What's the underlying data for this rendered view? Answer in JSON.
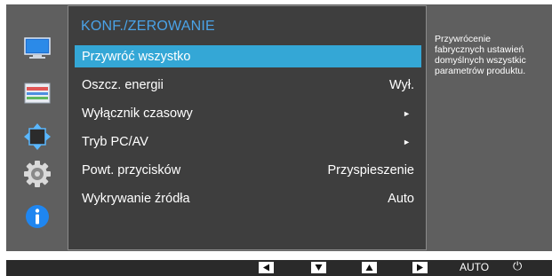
{
  "menu": {
    "title": "KONF./ZEROWANIE",
    "items": [
      {
        "label": "Przywróć wszystko",
        "value": "",
        "arrow": ""
      },
      {
        "label": "Oszcz. energii",
        "value": "Wył.",
        "arrow": ""
      },
      {
        "label": "Wyłącznik czasowy",
        "value": "",
        "arrow": "►"
      },
      {
        "label": "Tryb PC/AV",
        "value": "",
        "arrow": "►"
      },
      {
        "label": "Powt. przycisków",
        "value": "Przyspieszenie",
        "arrow": ""
      },
      {
        "label": "Wykrywanie źródła",
        "value": "Auto",
        "arrow": ""
      }
    ]
  },
  "description": {
    "lines": [
      "Przywrócenie",
      "fabrycznych ustawień",
      "domyślnych wszystkic",
      "parametrów produktu."
    ]
  },
  "sidebar": {
    "icons": [
      "monitor-icon",
      "color-bars-icon",
      "resize-arrows-icon",
      "gear-icon",
      "info-icon"
    ]
  },
  "buttons": {
    "auto_label": "AUTO",
    "power_symbol": "⏻"
  },
  "colors": {
    "accent": "#34a7d6",
    "title": "#4aa3e8",
    "panel": "#3e3e3e",
    "frame": "#5f5f5f"
  }
}
